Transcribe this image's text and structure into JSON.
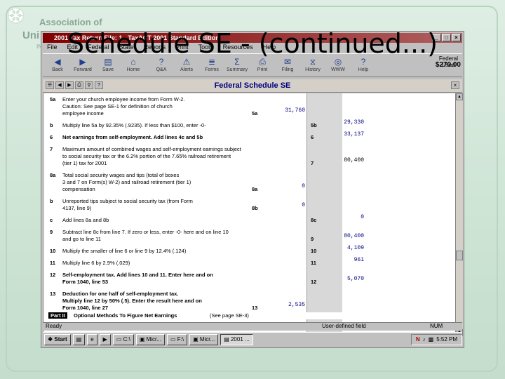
{
  "logo": {
    "line1": "Association of",
    "line2": "Uni",
    "line3": "INC"
  },
  "slide_title": "Schedule SE - (continued...)",
  "window": {
    "title": "2001 Tax Return File: 1 - TaxACT 2001 Standard Edition"
  },
  "menu": [
    "File",
    "Edit",
    "Federal",
    "State",
    "Reports",
    "Print",
    "Tools",
    "Resources",
    "Help"
  ],
  "toolbar": [
    "Back",
    "Forward",
    "Save",
    "Home",
    "Q&A",
    "Alerts",
    "Forms",
    "Summary",
    "Print",
    "Filing",
    "History",
    "WWW",
    "Help"
  ],
  "federal_used": {
    "label1": "Federal",
    "label2": "Used",
    "amount": "$270.00"
  },
  "form_title": "Federal Schedule SE",
  "lines": [
    {
      "ln": "5a",
      "desc": [
        "Enter your church employee income from Form W-2.",
        "Caution: See page SE-1 for definition of church",
        "employee income"
      ],
      "box": "5a",
      "value": "31,760",
      "boxcol": "mid"
    },
    {
      "ln": "b",
      "desc": [
        "Multiply line 5a by 92.35% (.9235). If less than $100, enter -0-"
      ],
      "box": "5b",
      "value": "29,330",
      "boxcol": "right"
    },
    {
      "ln": "6",
      "desc": [
        "Net earnings from self-employment. Add lines 4c and 5b"
      ],
      "box": "6",
      "value": "33,137",
      "boxcol": "right",
      "bold": true
    },
    {
      "ln": "7",
      "desc": [
        "Maximum amount of combined wages and self-employment earnings subject",
        "to social security tax or the 6.2% portion of the 7.65% railroad retirement",
        "(tier 1) tax for 2001"
      ],
      "box": "7",
      "value": "80,400",
      "boxcol": "right",
      "black": true
    },
    {
      "ln": "8a",
      "desc": [
        "Total social security wages and tips (total of boxes",
        "3 and 7 on Form(s) W-2) and railroad retirement (tier 1)",
        "compensation"
      ],
      "box": "8a",
      "value": "0",
      "boxcol": "mid"
    },
    {
      "ln": "b",
      "desc": [
        "Unreported tips subject to social security tax (from Form",
        "4137, line 9)"
      ],
      "box": "8b",
      "value": "0",
      "boxcol": "mid"
    },
    {
      "ln": "c",
      "desc": [
        "Add lines 8a and 8b"
      ],
      "box": "8c",
      "value": "0",
      "boxcol": "right"
    },
    {
      "ln": "9",
      "desc": [
        "Subtract line 8c from line 7. If zero or less, enter -0- here and on line 10",
        "and go to line 11"
      ],
      "box": "9",
      "value": "80,400",
      "boxcol": "right"
    },
    {
      "ln": "10",
      "desc": [
        "Multiply the smaller of line 6 or line 9 by 12.4% (.124)"
      ],
      "box": "10",
      "value": "4,109",
      "boxcol": "right"
    },
    {
      "ln": "11",
      "desc": [
        "Multiply line 6 by 2.9% (.029)"
      ],
      "box": "11",
      "value": "961",
      "boxcol": "right"
    },
    {
      "ln": "12",
      "desc": [
        "Self-employment tax. Add lines 10 and 11. Enter here and on",
        "Form 1040, line 53"
      ],
      "box": "12",
      "value": "5,070",
      "boxcol": "right",
      "bold": true
    },
    {
      "ln": "13",
      "desc": [
        "Deduction for one half of self-employment tax.",
        "Multiply line 12 by 50% (.5). Enter the result here and on",
        "Form 1040, line 27"
      ],
      "box": "13",
      "value": "2,535",
      "boxcol": "mid",
      "bold": true
    }
  ],
  "part": {
    "tag": "Part II",
    "title": "Optional Methods To Figure Net Earnings",
    "note": "(See page SE-3)"
  },
  "status": {
    "left": "Ready",
    "mid": "User-defined field",
    "right": "NUM"
  },
  "taskbar": {
    "start": "Start",
    "buttons": [
      "C:\\",
      "Micr...",
      "F:\\",
      "Micr...",
      "2001 ..."
    ],
    "active_index": 4,
    "clock": "5:52 PM"
  }
}
